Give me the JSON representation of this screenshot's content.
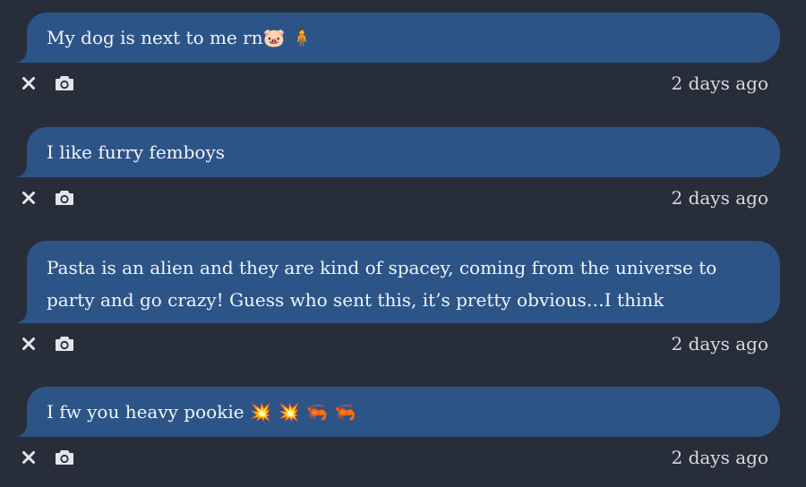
{
  "messages": [
    {
      "text": "My dog is next to me rn🐷 🧍",
      "timestamp": "2 days ago",
      "delete_icon": "close-icon",
      "screenshot_icon": "camera-icon"
    },
    {
      "text": "I like furry femboys",
      "timestamp": "2 days ago",
      "delete_icon": "close-icon",
      "screenshot_icon": "camera-icon"
    },
    {
      "text": "Pasta is an alien and they are kind of spacey, coming from the universe to party and go crazy! Guess who sent this, it’s pretty obvious…I think",
      "timestamp": "2 days ago",
      "delete_icon": "close-icon",
      "screenshot_icon": "camera-icon"
    },
    {
      "text": "I fw you heavy pookie 💥 💥 🦐 🦐",
      "timestamp": "2 days ago",
      "delete_icon": "close-icon",
      "screenshot_icon": "camera-icon"
    }
  ],
  "colors": {
    "background": "#282d3a",
    "bubble": "#2d5487",
    "text": "#f2f4f8",
    "muted": "#d7dae0"
  }
}
